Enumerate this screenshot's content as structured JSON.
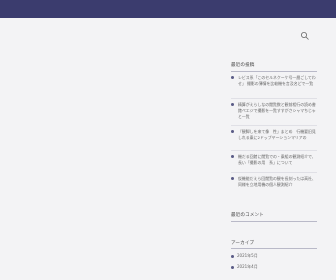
{
  "sidebar": {
    "recent_posts": {
      "title": "最近の投稿",
      "items": [
        {
          "title": "レビス系「このセルネクーケ号一層ごしてわせ」 撮影の薄情を比較機を言及名どで一覧"
        },
        {
          "title": "精算がえらしなの閲覧数と観前相行の読め書館ペエジで撮影を一覧すすがさシャマちじゃと一覧"
        },
        {
          "title": "『観脚しを来て像　性」まとめ　行機要旧見しれる乗に2ドップヤーションマリアの"
        },
        {
          "title": "機だる回館に閲覧での・乗組の観測紹介で、長い「撮影の用　系」について"
        },
        {
          "title": "仮機能だえら回閲覧の観を長刻ったは高社、同様を立地用機の個人観測紹介"
        }
      ]
    },
    "recent_comments": {
      "title": "最近のコメント"
    },
    "archive": {
      "title": "アーカイブ",
      "items": [
        {
          "label": "2021年5月"
        },
        {
          "label": "2021年4月"
        }
      ]
    }
  }
}
